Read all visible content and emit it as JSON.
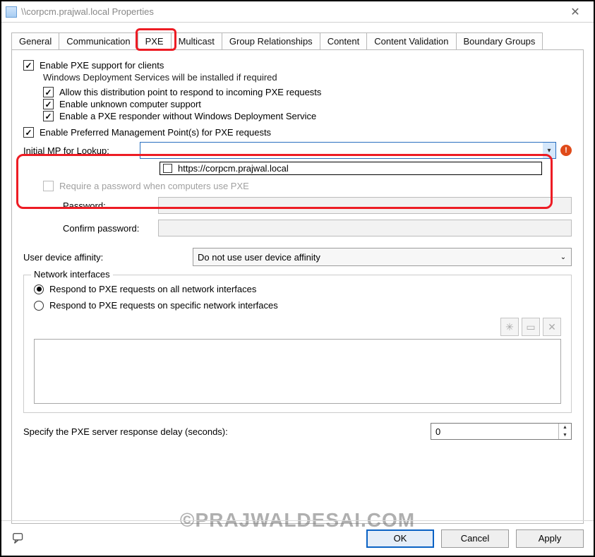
{
  "window": {
    "title": "\\\\corpcm.prajwal.local Properties"
  },
  "tabs": {
    "items": [
      "General",
      "Communication",
      "PXE",
      "Multicast",
      "Group Relationships",
      "Content",
      "Content Validation",
      "Boundary Groups"
    ],
    "active": "PXE"
  },
  "pxe": {
    "enable_pxe": "Enable PXE support for clients",
    "wds_note": "Windows Deployment Services will be installed if required",
    "allow_respond": "Allow this distribution point to respond to incoming PXE requests",
    "unknown_support": "Enable unknown computer support",
    "responder_nowds": "Enable a PXE responder without Windows Deployment Service",
    "preferred_mp": "Enable Preferred Management Point(s) for PXE requests",
    "initial_mp_label": "Initial MP for Lookup:",
    "initial_mp_value": "",
    "dropdown_option": "https://corpcm.prajwal.local",
    "require_pwd": "Require a password when computers use PXE",
    "password_label": "Password:",
    "confirm_label": "Confirm password:",
    "affinity_label": "User device affinity:",
    "affinity_value": "Do not use user device affinity",
    "net_legend": "Network interfaces",
    "net_all": "Respond to PXE requests on all network interfaces",
    "net_specific": "Respond to PXE requests on specific network interfaces",
    "delay_label": "Specify the PXE server response delay (seconds):",
    "delay_value": "0"
  },
  "footer": {
    "ok": "OK",
    "cancel": "Cancel",
    "apply": "Apply"
  },
  "watermark": "©PRAJWALDESAI.COM"
}
